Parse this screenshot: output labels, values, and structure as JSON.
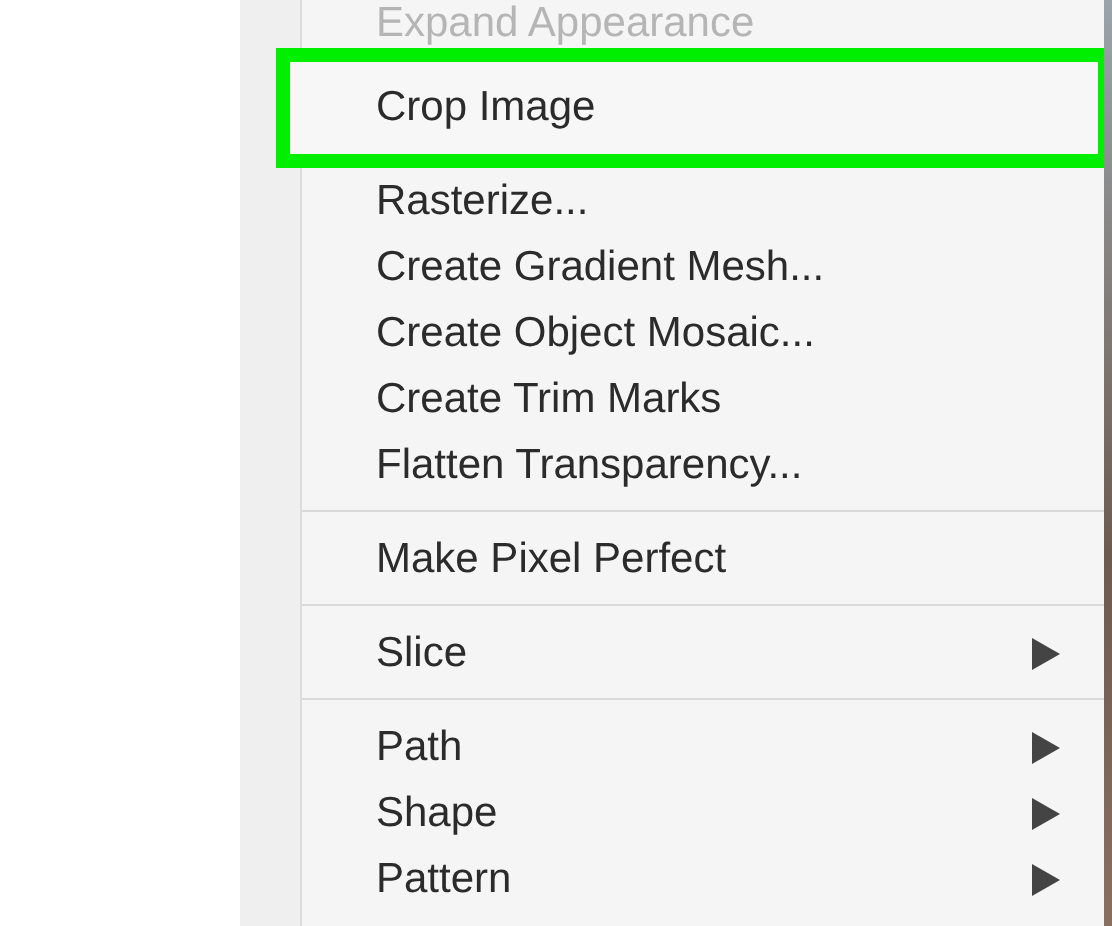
{
  "menu": {
    "items": [
      {
        "kind": "item",
        "label": "Expand Appearance",
        "disabled": true,
        "highlighted": false,
        "submenu": false
      },
      {
        "kind": "item",
        "label": "Crop Image",
        "disabled": false,
        "highlighted": true,
        "submenu": false
      },
      {
        "kind": "item",
        "label": "Rasterize...",
        "disabled": false,
        "highlighted": false,
        "submenu": false
      },
      {
        "kind": "item",
        "label": "Create Gradient Mesh...",
        "disabled": false,
        "highlighted": false,
        "submenu": false
      },
      {
        "kind": "item",
        "label": "Create Object Mosaic...",
        "disabled": false,
        "highlighted": false,
        "submenu": false
      },
      {
        "kind": "item",
        "label": "Create Trim Marks",
        "disabled": false,
        "highlighted": false,
        "submenu": false
      },
      {
        "kind": "item",
        "label": "Flatten Transparency...",
        "disabled": false,
        "highlighted": false,
        "submenu": false
      },
      {
        "kind": "separator"
      },
      {
        "kind": "item",
        "label": "Make Pixel Perfect",
        "disabled": false,
        "highlighted": false,
        "submenu": false
      },
      {
        "kind": "separator"
      },
      {
        "kind": "item",
        "label": "Slice",
        "disabled": false,
        "highlighted": false,
        "submenu": true
      },
      {
        "kind": "separator"
      },
      {
        "kind": "item",
        "label": "Path",
        "disabled": false,
        "highlighted": false,
        "submenu": true
      },
      {
        "kind": "item",
        "label": "Shape",
        "disabled": false,
        "highlighted": false,
        "submenu": true
      },
      {
        "kind": "item",
        "label": "Pattern",
        "disabled": false,
        "highlighted": false,
        "submenu": true
      }
    ]
  }
}
